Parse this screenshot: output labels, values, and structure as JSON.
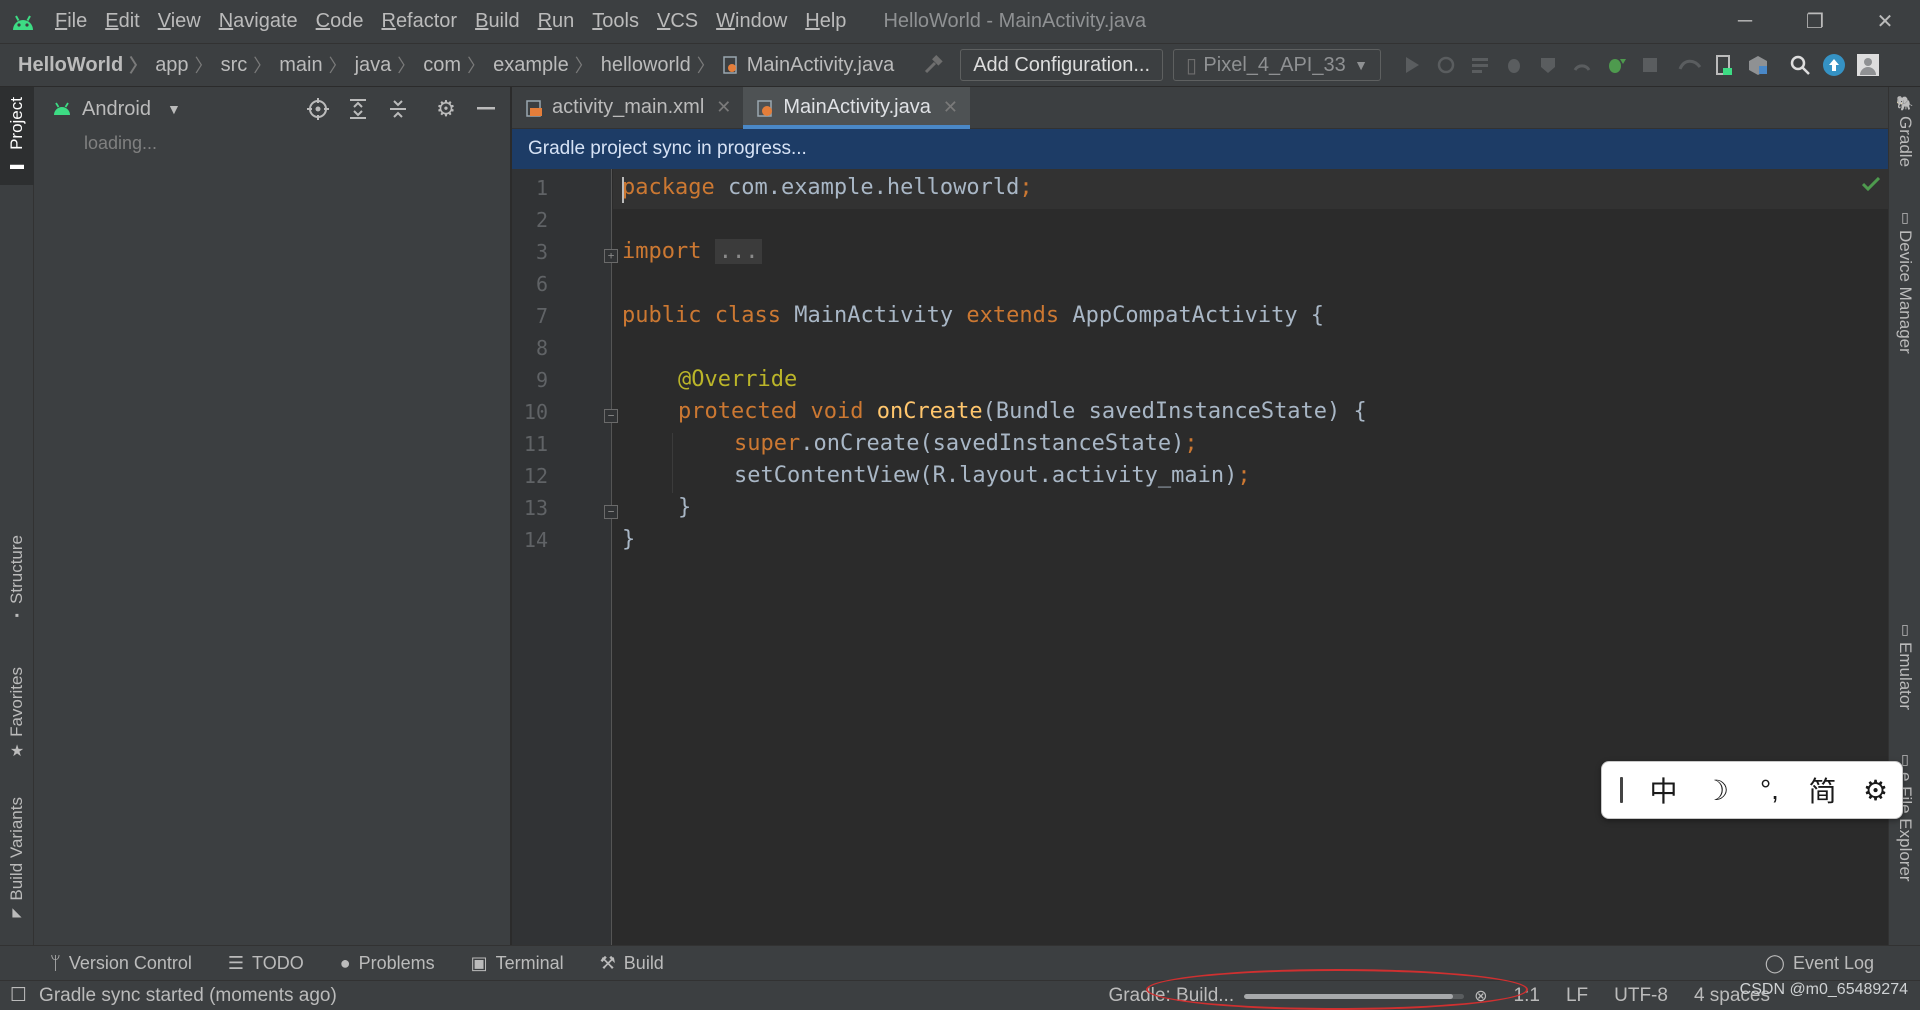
{
  "window": {
    "title": "HelloWorld - MainActivity.java",
    "controls": {
      "minimize": "─",
      "restore": "❐",
      "close": "✕"
    }
  },
  "menu": {
    "items": [
      {
        "mnemonic": "F",
        "rest": "ile"
      },
      {
        "mnemonic": "E",
        "rest": "dit"
      },
      {
        "mnemonic": "V",
        "rest": "iew"
      },
      {
        "mnemonic": "N",
        "rest": "avigate"
      },
      {
        "mnemonic": "C",
        "rest": "ode"
      },
      {
        "mnemonic": "R",
        "rest": "efactor"
      },
      {
        "mnemonic": "B",
        "rest": "uild"
      },
      {
        "mnemonic": "R",
        "rest": "un"
      },
      {
        "mnemonic": "T",
        "rest": "ools"
      },
      {
        "mnemonic": "V",
        "rest": "CS"
      },
      {
        "mnemonic": "W",
        "rest": "indow"
      },
      {
        "mnemonic": "H",
        "rest": "elp"
      }
    ]
  },
  "breadcrumb": [
    "HelloWorld",
    "app",
    "src",
    "main",
    "java",
    "com",
    "example",
    "helloworld",
    "MainActivity.java"
  ],
  "toolbar": {
    "add_configuration": "Add Configuration...",
    "device": "Pixel_4_API_33"
  },
  "project_panel": {
    "view_mode": "Android",
    "loading": "loading..."
  },
  "left_stripe": {
    "project": "Project",
    "structure": "Structure",
    "favorites": "Favorites",
    "build_variants": "Build Variants"
  },
  "right_stripe": {
    "gradle": "Gradle",
    "device_manager": "Device Manager",
    "emulator": "Emulator",
    "device_file_explorer": "e File Explorer"
  },
  "editor_tabs": [
    {
      "label": "activity_main.xml",
      "active": false
    },
    {
      "label": "MainActivity.java",
      "active": true
    }
  ],
  "sync_banner": "Gradle project sync in progress...",
  "code": {
    "line_numbers": [
      "1",
      "2",
      "3",
      "6",
      "7",
      "8",
      "9",
      "10",
      "11",
      "12",
      "13",
      "14"
    ],
    "package_kw": "package",
    "package_name": " com.example.helloworld",
    "semicolon": ";",
    "import_kw": "import",
    "import_fold": "...",
    "public_kw": "public",
    "class_kw": "class",
    "class_name": "MainActivity",
    "extends_kw": "extends",
    "super_class": "AppCompatActivity {",
    "annotation": "@Override",
    "protected_kw": "protected",
    "void_kw": "void",
    "method_name": "onCreate",
    "method_params": "(Bundle savedInstanceState) {",
    "super_kw": "super",
    "super_call": ".onCreate(savedInstanceState)",
    "set_content": "setContentView(R.layout.activity_main)",
    "close_method": "}",
    "close_class": "}"
  },
  "ime": {
    "lang": "中",
    "moon": "☽",
    "punct": "°,",
    "simplified": "简",
    "settings": "⚙"
  },
  "bottom_tabs": [
    "Version Control",
    "TODO",
    "Problems",
    "Terminal",
    "Build"
  ],
  "event_log": "Event Log",
  "status": {
    "message": "Gradle sync started (moments ago)",
    "progress_label": "Gradle: Build...",
    "progress": 0.95,
    "position": "1:1",
    "line_sep": "LF",
    "encoding": "UTF-8",
    "indent": "4 spaces",
    "watermark": "CSDN @m0_65489274"
  },
  "colors": {
    "accent": "#4a88c7",
    "keyword": "#cc7832",
    "function": "#ffc66d",
    "annotation": "#bbb529",
    "plain_code": "#a9b7c6",
    "android_green": "#3ddc84",
    "sync_banner_bg": "#1d3c66"
  }
}
